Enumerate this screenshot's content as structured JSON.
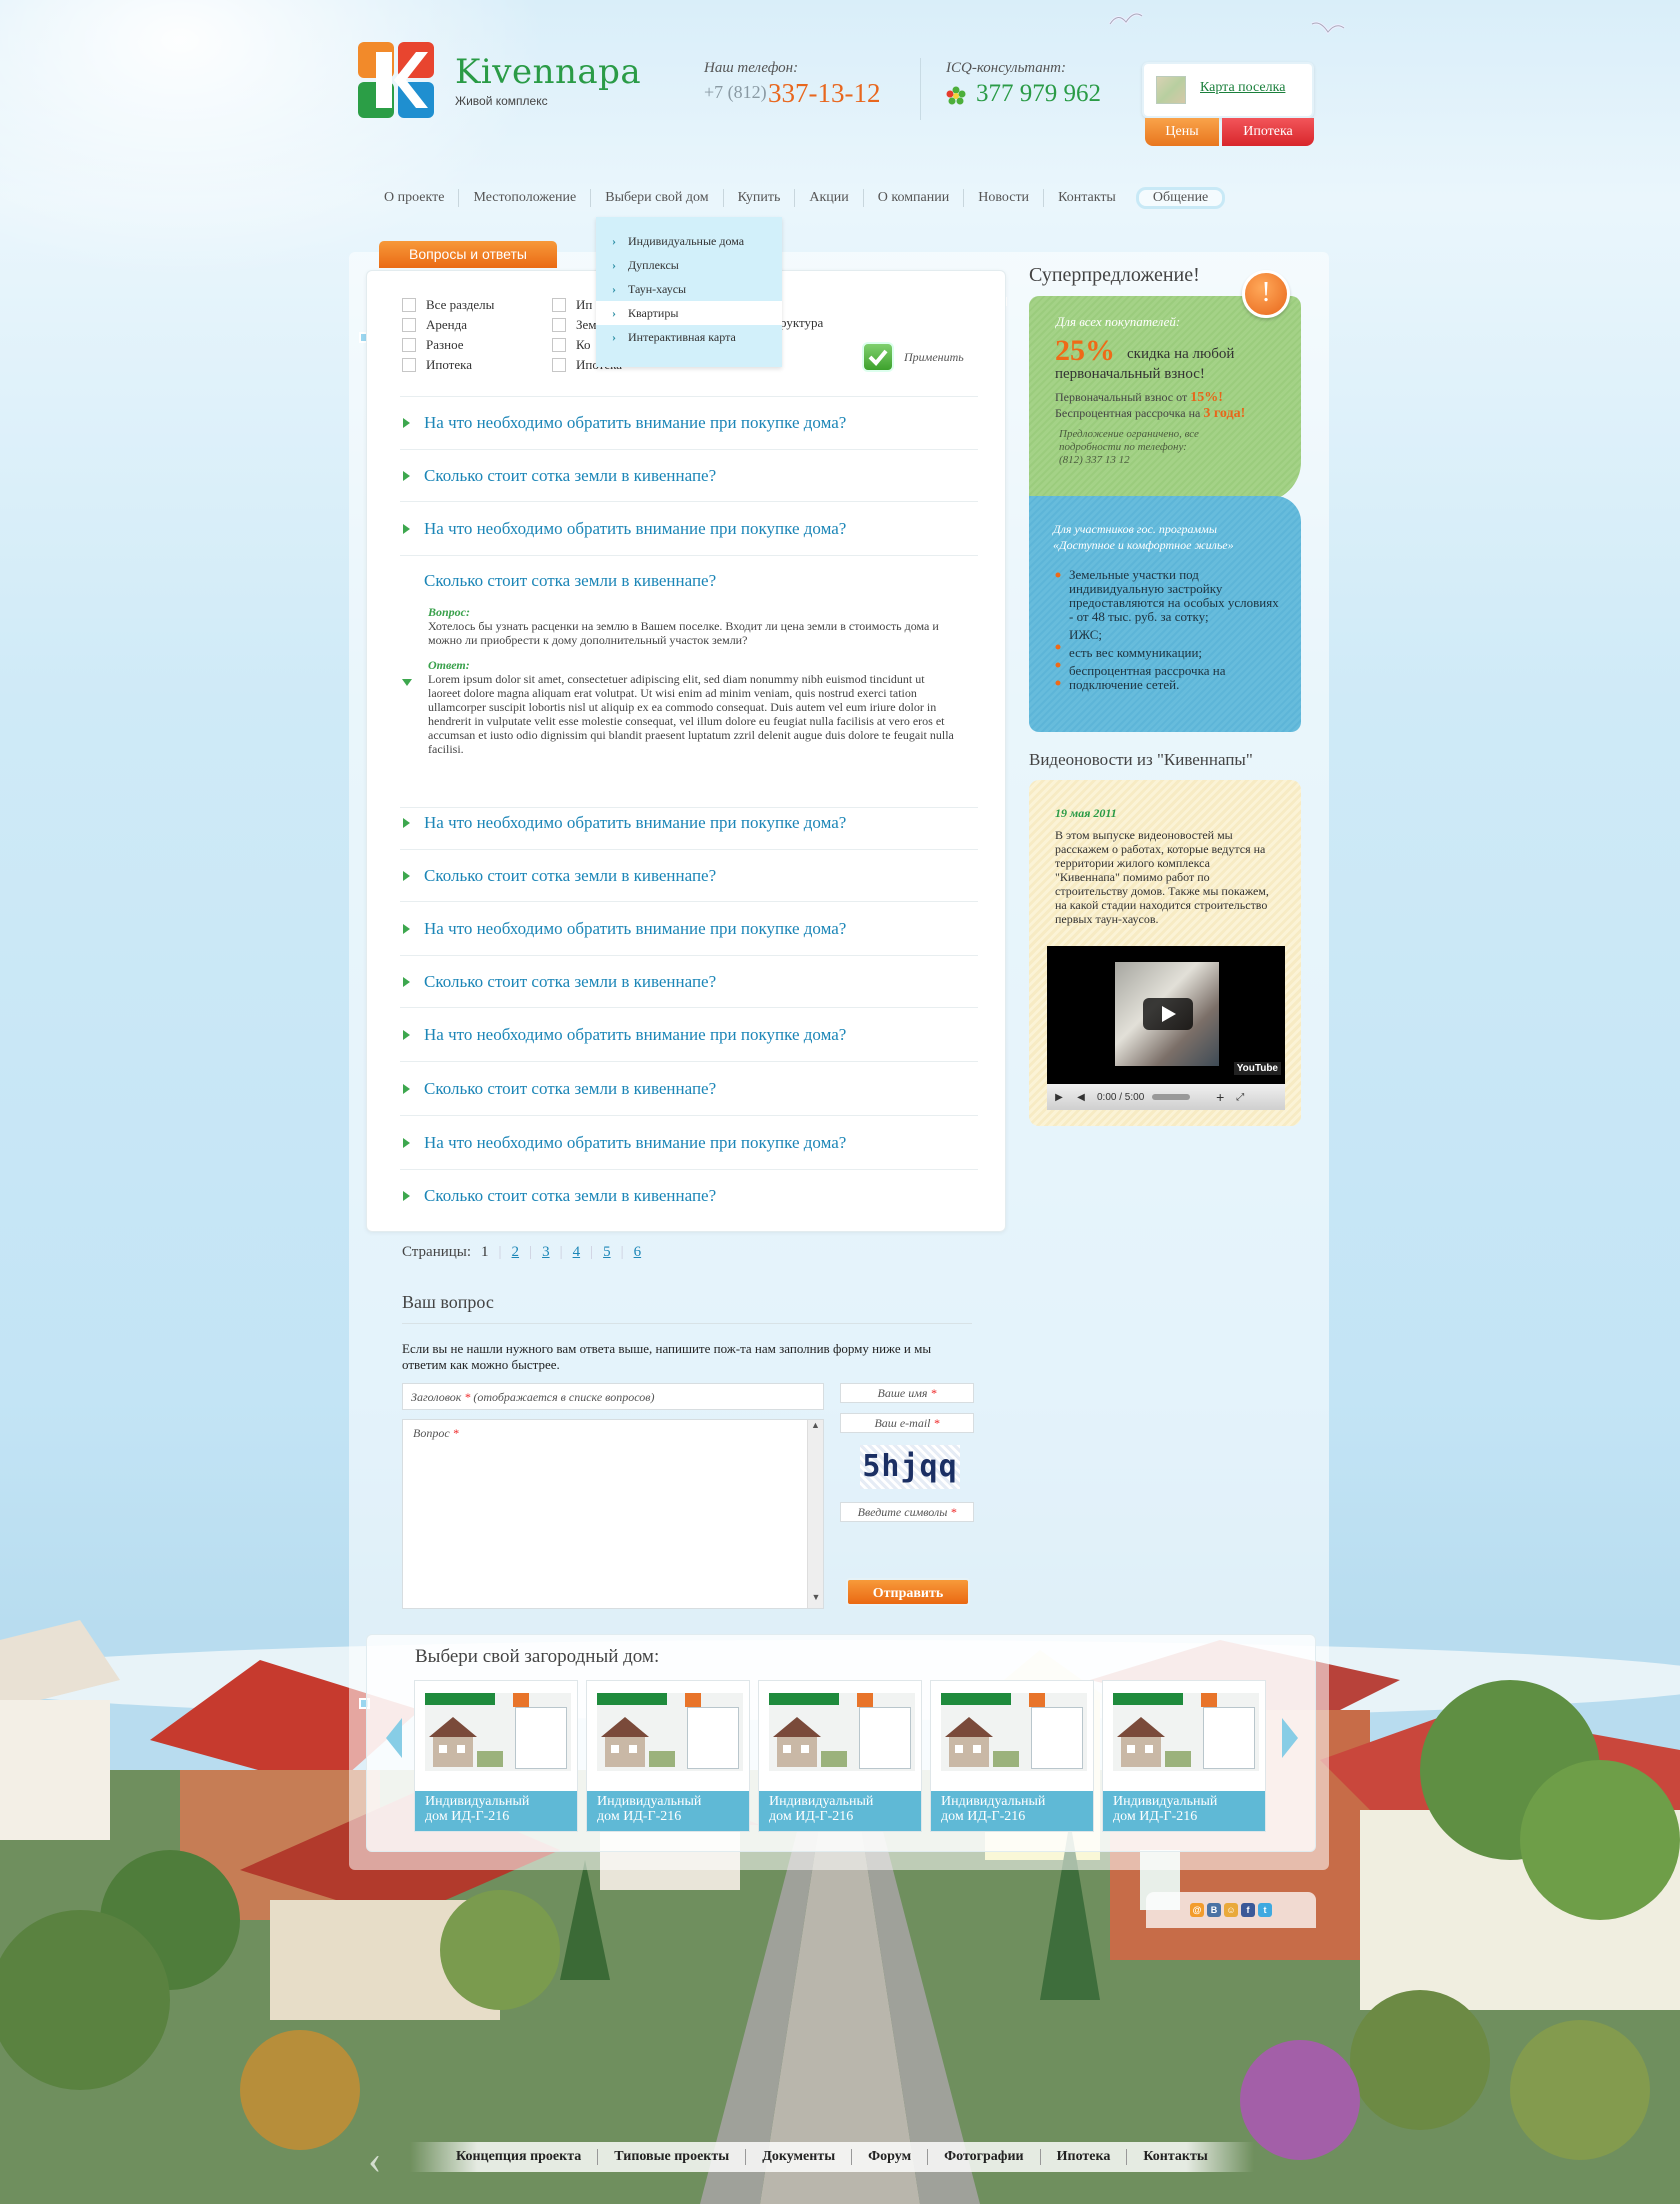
{
  "header": {
    "logo_name": "Kivennapa",
    "logo_sub": "Живой комплекс",
    "phone_label": "Наш телефон:",
    "phone_code": "+7 (812)",
    "phone_number": "337-13-12",
    "icq_label": "ICQ-консультант:",
    "icq_number": "377 979 962",
    "map_link": "Карта поселка",
    "prices_btn": "Цены",
    "mortgage_btn": "Ипотека"
  },
  "nav": {
    "items": [
      "О проекте",
      "Местоположение",
      "Выбери свой дом",
      "Купить",
      "Акции",
      "О компании",
      "Новости",
      "Контакты",
      "Общение"
    ],
    "dropdown": [
      "Индивидуальные дома",
      "Дуплексы",
      "Таун-хаусы",
      "Квартиры",
      "Интерактивная карта"
    ]
  },
  "qa": {
    "tab": "Вопросы и ответы",
    "filters_col1": [
      "Все разделы",
      "Аренда",
      "Разное",
      "Ипотека"
    ],
    "filters_col2": [
      "Ип",
      "Зем",
      "Ко",
      "Ипотека"
    ],
    "filter_partial": "руктура",
    "apply": "Применить",
    "questions": [
      "На что необходимо обратить внимание при покупке дома?",
      "Сколько стоит сотка земли в кивеннапе?",
      "На что необходимо обратить внимание при покупке дома?",
      "Сколько стоит сотка земли в кивеннапе?",
      "На что необходимо обратить внимание при покупке дома?",
      "Сколько стоит сотка земли в кивеннапе?",
      "На что необходимо обратить внимание при покупке дома?",
      "Сколько стоит сотка земли в кивеннапе?",
      "На что необходимо обратить внимание при покупке дома?",
      "Сколько стоит сотка земли в кивеннапе?",
      "На что необходимо обратить внимание при покупке дома?",
      "Сколько стоит сотка земли в кивеннапе?"
    ],
    "question_label": "Вопрос:",
    "question_text": "Хотелось бы узнать расценки на землю в Вашем поселке. Входит ли цена земли в стоимость дома и можно ли приобрести к дому дополнительный участок земли?",
    "answer_label": "Ответ:",
    "answer_text": "Lorem ipsum dolor sit amet, consectetuer adipiscing elit, sed diam nonummy nibh euismod tincidunt ut laoreet dolore magna aliquam erat volutpat. Ut wisi enim ad minim veniam, quis nostrud exerci tation ullamcorper suscipit lobortis nisl ut aliquip ex ea commodo consequat. Duis autem vel eum iriure dolor in hendrerit in vulputate velit esse molestie consequat, vel illum dolore eu feugiat nulla facilisis at vero eros et accumsan et iusto odio dignissim qui blandit praesent luptatum zzril delenit augue duis dolore te feugait nulla facilisi."
  },
  "pager": {
    "label": "Страницы:",
    "pages": [
      "1",
      "2",
      "3",
      "4",
      "5",
      "6"
    ],
    "current": "1"
  },
  "form": {
    "title": "Ваш вопрос",
    "intro": "Если вы не нашли нужного вам ответа выше, напишите пож-та нам заполнив форму ниже и мы ответим как можно быстрее.",
    "head_placeholder": "Заголовок",
    "head_hint": "(отображается в списке вопросов)",
    "question_placeholder": "Вопрос",
    "name_placeholder": "Ваше имя",
    "email_placeholder": "Ваш e-mail",
    "captcha_text": "5hjqq",
    "captcha_placeholder": "Введите символы",
    "submit": "Отправить",
    "required_mark": "*"
  },
  "houses": {
    "title": "Выбери свой загородный дом:",
    "items": [
      {
        "line1": "Индивидуальный",
        "line2": "дом ИД-Г-216"
      },
      {
        "line1": "Индивидуальный",
        "line2": "дом ИД-Г-216"
      },
      {
        "line1": "Индивидуальный",
        "line2": "дом ИД-Г-216"
      },
      {
        "line1": "Индивидуальный",
        "line2": "дом ИД-Г-216"
      },
      {
        "line1": "Индивидуальный",
        "line2": "дом ИД-Г-216"
      }
    ]
  },
  "sidebar": {
    "offer_title": "Суперпредложение!",
    "offer_mark": "!",
    "green": {
      "heading": "Для всех покупателей:",
      "big": "25%",
      "line1": "скидка на любой",
      "line2": "первоначальный взнос!",
      "l3a": "Первоначальный взнос от",
      "l3b": "15%!",
      "l4a": "Беспроцентная рассрочка на",
      "l4b": "3 года!",
      "note1": "Предложение ограничено, все",
      "note2": "подробности по телефону:",
      "note3": "(812) 337 13 12"
    },
    "blue": {
      "heading1": "Для участников гос. программы",
      "heading2": "«Доступное и комфортное жилье»",
      "bullets": [
        "Земельные участки под индивидуальную застройку предоставляются на особых условиях - от 48 тыс. руб. за сотку;",
        "ИЖС;",
        "есть вес коммуникации;",
        "беспроцентная рассрочка на подключение сетей."
      ]
    },
    "video_title": "Видеоновости из \"Кивеннапы\"",
    "video_date": "19 мая 2011",
    "video_text": "В этом выпуске видеоновостей мы расскажем о работах, которые ведутся на территории жилого комплекса \"Кивеннапа\" помимо работ по строительству домов. Также мы покажем, на какой стадии находится строительство первых таун-хаусов.",
    "video_time": "0:00 / 5:00",
    "video_brand": "YouTube"
  },
  "social": [
    "ok-icon",
    "vk-icon",
    "mm-icon",
    "facebook-icon",
    "twitter-icon"
  ],
  "footer": [
    "Концепция проекта",
    "Типовые проекты",
    "Документы",
    "Форум",
    "Фотографии",
    "Ипотека",
    "Контакты"
  ],
  "colors": {
    "accent_orange": "#ea6a14",
    "brand_green": "#2a9b46",
    "link_blue": "#1c86b7",
    "tile_blue": "#5fb9d6"
  }
}
